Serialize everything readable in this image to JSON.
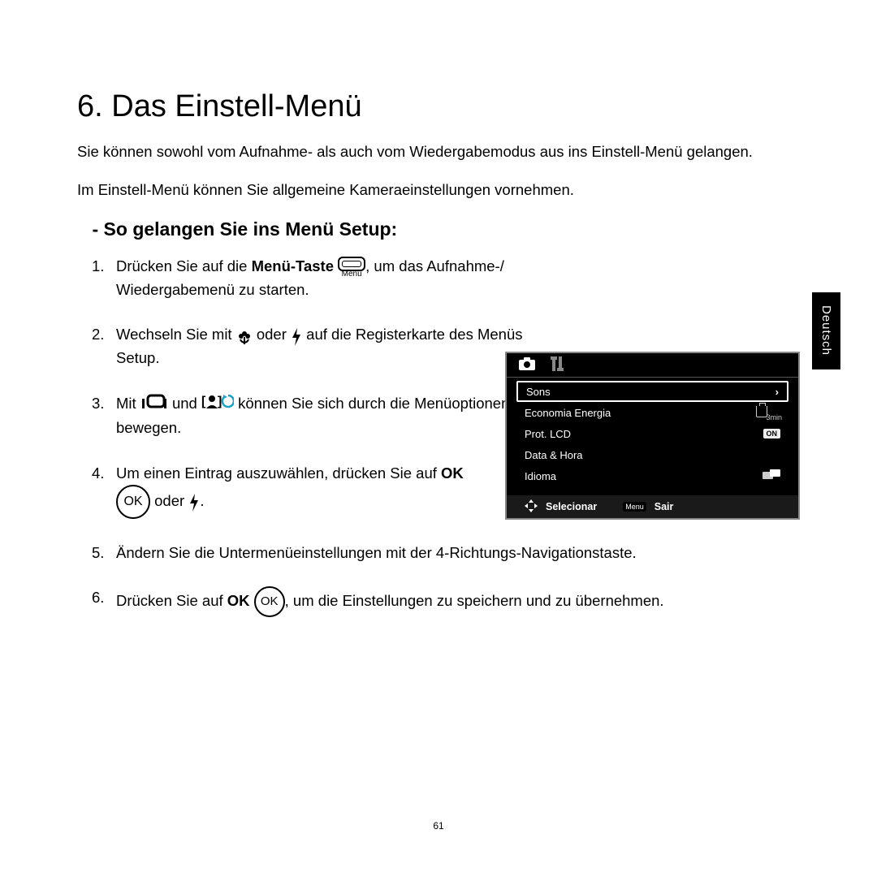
{
  "heading": "6. Das Einstell-Menü",
  "intro1": "Sie können sowohl vom Aufnahme- als auch vom Wiedergabemodus aus ins Einstell-Menü gelangen.",
  "intro2": "Im Einstell-Menü können Sie allgemeine Kameraeinstellungen vornehmen.",
  "subheading": "- So gelangen Sie ins Menü Setup:",
  "steps": {
    "s1a": "Drücken Sie auf die ",
    "s1b": "Menü-Taste",
    "s1c": ", um das Aufnahme-/ Wiedergabemenü zu starten.",
    "menuLabel": "Menu",
    "s2a": "Wechseln Sie mit ",
    "s2b": " oder ",
    "s2c": " auf die Registerkarte des Menüs Setup.",
    "s3a": "Mit ",
    "s3b": " und ",
    "s3c": " können Sie sich durch die Menüoptionen bewegen.",
    "s4a": "Um einen Eintrag auszuwählen, drücken Sie auf ",
    "s4b": "OK",
    "s4ok": "OK",
    "s4c": " oder ",
    "s4d": ".",
    "s5": "Ändern Sie die Untermenüeinstellungen mit der 4-Richtungs-Navigationstaste.",
    "s6a": "Drücken Sie auf ",
    "s6b": "OK",
    "s6ok": "OK",
    "s6c": ", um die Einstellungen zu speichern und zu übernehmen."
  },
  "sideTab": "Deutsch",
  "screenshot": {
    "rows": [
      {
        "label": "Sons",
        "value": "›",
        "selected": true
      },
      {
        "label": "Economia Energia",
        "value": "3min"
      },
      {
        "label": "Prot. LCD",
        "value": "ON"
      },
      {
        "label": "Data & Hora",
        "value": ""
      },
      {
        "label": "Idioma",
        "value": "icon"
      }
    ],
    "footerSelect": "Selecionar",
    "footerMenu": "Menu",
    "footerExit": "Sair"
  },
  "pageNumber": "61"
}
